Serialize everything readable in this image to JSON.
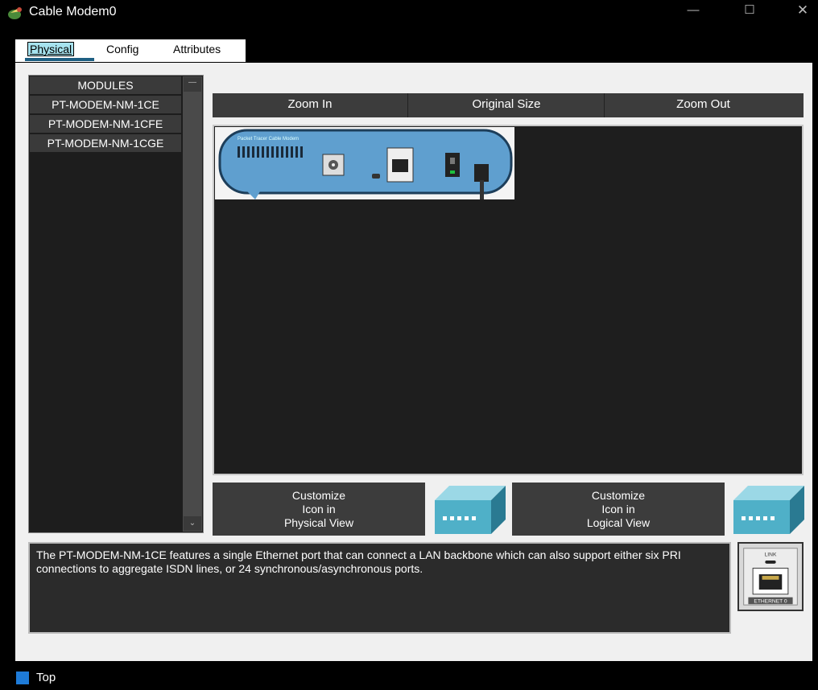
{
  "window": {
    "title": "Cable Modem0",
    "minimize": "—",
    "maximize": "☐",
    "close": "✕"
  },
  "tabs": [
    {
      "label": "Physical"
    },
    {
      "label": "Config"
    },
    {
      "label": "Attributes"
    }
  ],
  "modules": {
    "header": "MODULES",
    "items": [
      "PT-MODEM-NM-1CE",
      "PT-MODEM-NM-1CFE",
      "PT-MODEM-NM-1CGE"
    ],
    "scroll_up": "—",
    "scroll_down": "⌄"
  },
  "zoom": {
    "zoom_in": "Zoom In",
    "original": "Original Size",
    "zoom_out": "Zoom Out"
  },
  "device": {
    "brand_text": "Packet Tracer Cable Modem",
    "color": "#5f9fcf"
  },
  "customize": {
    "physical": [
      "Customize",
      "Icon in",
      "Physical View"
    ],
    "logical": [
      "Customize",
      "Icon in",
      "Logical View"
    ]
  },
  "description": "The PT-MODEM-NM-1CE features a single Ethernet port that can connect a LAN backbone which can also support either six PRI connections to aggregate ISDN lines, or 24 synchronous/asynchronous ports.",
  "port": {
    "top_label": "LINK",
    "bottom_label": "ETHERNET 0"
  },
  "status": {
    "text": "Top",
    "color": "#1e7bd8"
  }
}
